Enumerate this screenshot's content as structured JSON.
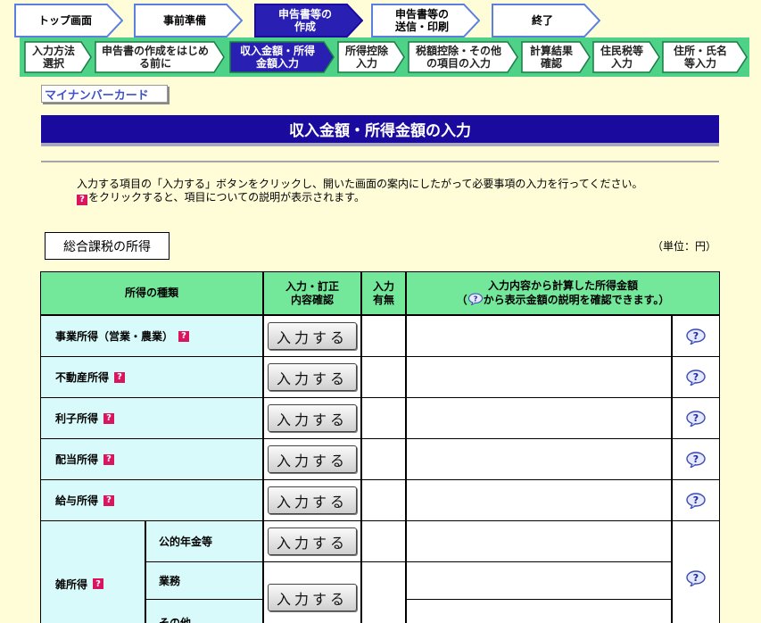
{
  "steps": [
    {
      "label": "トップ画面",
      "active": false
    },
    {
      "label": "事前準備",
      "active": false
    },
    {
      "label": "申告書等の\n作成",
      "active": true
    },
    {
      "label": "申告書等の\n送信・印刷",
      "active": false
    },
    {
      "label": "終了",
      "active": false
    }
  ],
  "substeps": [
    {
      "label": "入力方法\n選択",
      "active": false
    },
    {
      "label": "申告書の作成をはじめ\nる前に",
      "active": false
    },
    {
      "label": "収入金額・所得\n金額入力",
      "active": true
    },
    {
      "label": "所得控除\n入力",
      "active": false
    },
    {
      "label": "税額控除・その他\nの項目の入力",
      "active": false
    },
    {
      "label": "計算結果\n確認",
      "active": false
    },
    {
      "label": "住民税等\n入力",
      "active": false
    },
    {
      "label": "住所・氏名\n等入力",
      "active": false
    }
  ],
  "mynumber_card_label": "マイナンバーカード",
  "page_title": "収入金額・所得金額の入力",
  "description": {
    "line1": "入力する項目の「入力する」ボタンをクリックし、開いた画面の案内にしたがって必要事項の入力を行ってください。",
    "line2": "をクリックすると、項目についての説明が表示されます。",
    "help_glyph": "?"
  },
  "section_title": "総合課税の所得",
  "unit_label": "（単位：円）",
  "table": {
    "header": {
      "type": "所得の種類",
      "action": "入力・訂正\n内容確認",
      "has_input": "入力\n有無",
      "amount_line1": "入力内容から計算した所得金額",
      "amount_pre": "（",
      "amount_post": "から表示金額の説明を確認できます。）"
    },
    "input_button_label": "入力する",
    "rows": [
      {
        "name": "事業所得（営業・農業）"
      },
      {
        "name": "不動産所得"
      },
      {
        "name": "利子所得"
      },
      {
        "name": "配当所得"
      },
      {
        "name": "給与所得"
      }
    ],
    "misc": {
      "name": "雑所得",
      "sub": [
        "公的年金等",
        "業務",
        "その他"
      ]
    }
  },
  "colors": {
    "background": "#fffdd8",
    "title_bar": "#1a0a9e",
    "active_tab": "#2a1fb3",
    "header_green": "#74e89a",
    "name_cell": "#d8fafa",
    "help_pink": "#d9155f"
  }
}
